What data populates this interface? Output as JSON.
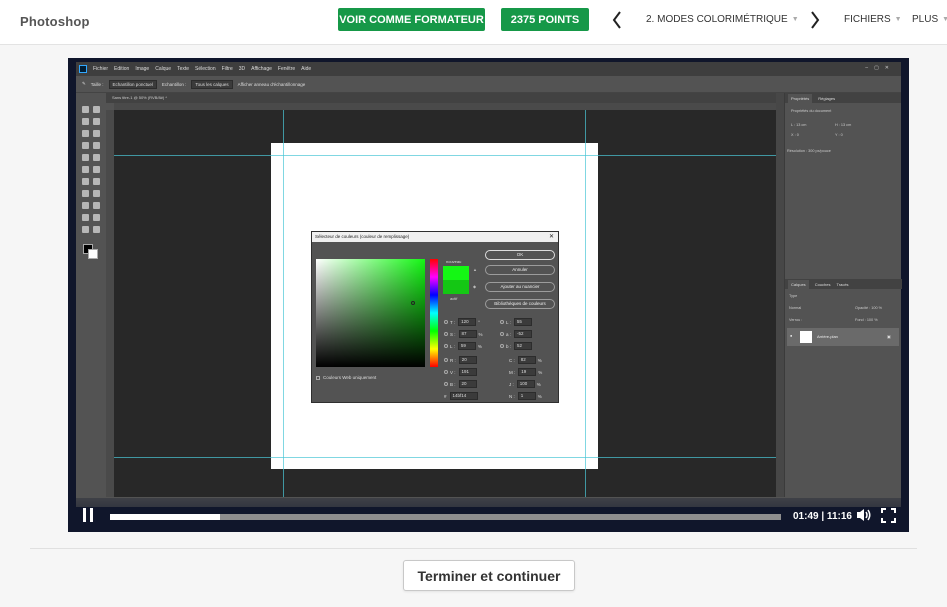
{
  "header": {
    "app_title": "Photoshop",
    "trainer_button": "VOIR COMME FORMATEUR",
    "points_button": "2375 POINTS",
    "lesson_title": "2. MODES COLORIMÉTRIQUE",
    "files_label": "FICHIERS",
    "more_label": "PLUS",
    "prev_icon": "chevron-left-icon",
    "next_icon": "chevron-right-icon",
    "accent_color": "#169848"
  },
  "video": {
    "current_time": "01:49",
    "duration": "11:16",
    "time_display": "01:49 | 11:16",
    "progress": 0.164,
    "photoshop": {
      "menus": [
        "Fichier",
        "Edition",
        "Image",
        "Calque",
        "Texte",
        "Sélection",
        "Filtre",
        "3D",
        "Affichage",
        "Fenêtre",
        "Aide"
      ],
      "options": {
        "size_label": "Taille :",
        "size_value": "Echantillon ponctuel",
        "sample_label": "Echantillon :",
        "sample_value": "Tous les calques",
        "ring_label": "Afficher anneau d'échantillonnage"
      },
      "doc_tab": "Sans titre-1 @ 50% (RVB/8#) *",
      "dialog": {
        "title": "Sélecteur de couleurs (couleur de remplissage)",
        "new_label": "nouveau",
        "current_label": "actif",
        "ok": "OK",
        "cancel": "Annuler",
        "add_swatch": "Ajouter au nuancier",
        "libraries": "Bibliothèques de couleurs",
        "web_only": "Couleurs Web uniquement",
        "fields": {
          "T": "120",
          "S": "87",
          "Lum": "59",
          "R": "20",
          "V": "191",
          "B": "20",
          "L": "55",
          "a": "-52",
          "b": "52",
          "C": "82",
          "M": "19",
          "J": "100",
          "N": "1",
          "hex": "14bf14"
        },
        "units": {
          "deg": "°",
          "pct": "%"
        }
      },
      "panels": {
        "tabs": [
          "Propriétés",
          "Réglages"
        ],
        "doc_props": "Propriétés du document",
        "width": "L : 13 cm",
        "height": "H : 13 cm",
        "x": "X : 0",
        "y": "Y : 0",
        "resolution": "Résolution : 300 px/pouce",
        "layer_tabs": [
          "Calques",
          "Couches",
          "Tracés"
        ],
        "layer_kind": "Type",
        "blend_mode": "Normal",
        "opacity": "Opacité : 100 %",
        "lock": "Verrou :",
        "fill": "Fond : 100 %",
        "layer_name": "Arrière-plan"
      }
    }
  },
  "footer": {
    "finish_button": "Terminer et continuer"
  }
}
